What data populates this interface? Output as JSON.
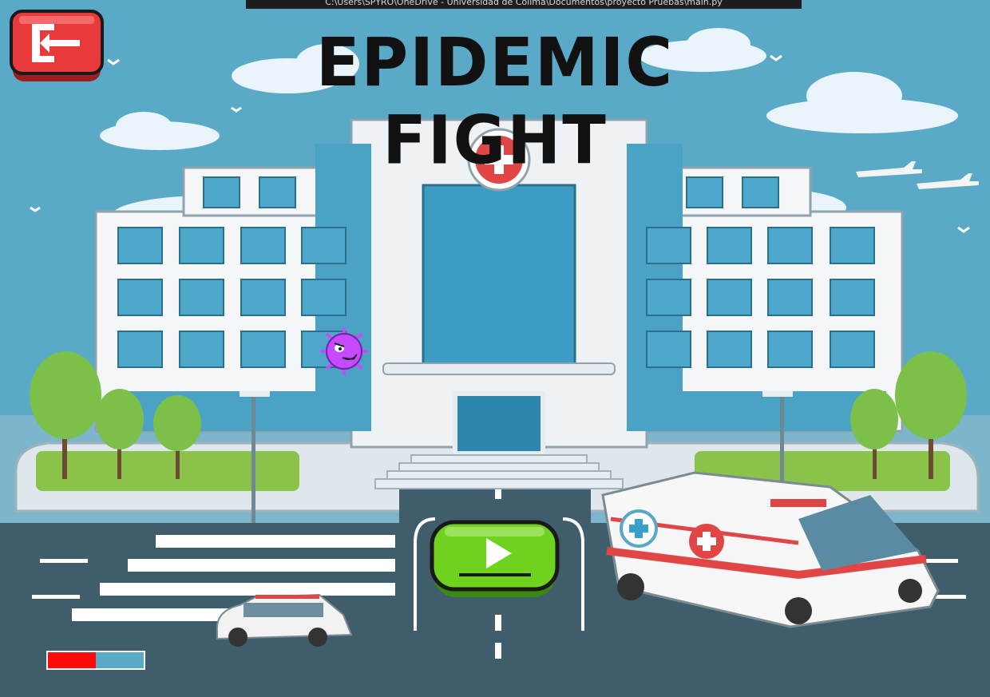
{
  "window": {
    "title_text": "C:\\Users\\SPYRO\\OneDrive - Universidad de Colima\\Documentos\\proyecto Pruebas\\main.py"
  },
  "game": {
    "title": "EPIDEMIC FIGHT"
  },
  "progress": {
    "fraction": 0.5
  },
  "colors": {
    "sky": "#5aa9c6",
    "exit_button": "#e83a3a",
    "play_button": "#6fd21e",
    "virus": "#c64bff",
    "progress_fill": "#ff0a0a"
  },
  "icons": {
    "exit": "exit-door-icon",
    "play": "play-triangle-icon",
    "virus": "virus-character-icon"
  }
}
